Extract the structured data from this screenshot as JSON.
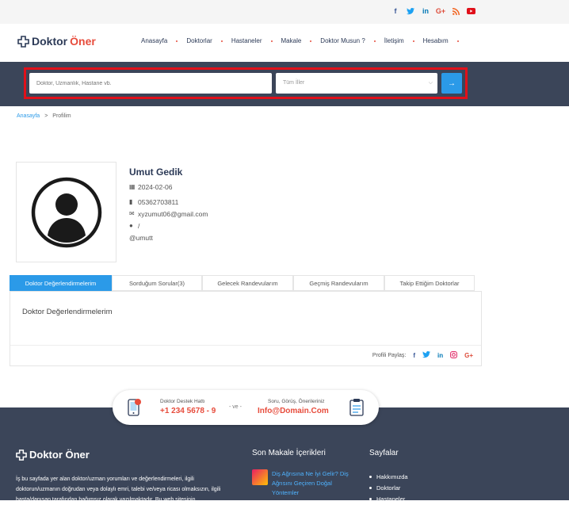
{
  "social": {
    "facebook": "f",
    "twitter": "t",
    "linkedin": "in",
    "google": "G+",
    "rss": "rss",
    "youtube": "yt"
  },
  "header": {
    "logo_part1": "Doktor",
    "logo_part2": "Öner",
    "nav": [
      "Anasayfa",
      "Doktorlar",
      "Hastaneler",
      "Makale",
      "Doktor Musun ?",
      "İletişim",
      "Hesabım"
    ]
  },
  "search": {
    "placeholder": "Doktor, Uzmanlık, Hastane vb.",
    "city_value": "Tüm İller",
    "submit_icon": "arrow-right-icon"
  },
  "breadcrumb": {
    "home": "Anasayfa",
    "separator": ">",
    "current": "Profilim"
  },
  "profile": {
    "name": "Umut Gedik",
    "date": "2024-02-06",
    "phone": "05362703811",
    "email": "xyzumut06@gmail.com",
    "location": "/",
    "username": "@umutt"
  },
  "tabs": {
    "items": [
      "Doktor Değerlendirmelerim",
      "Sorduğum Sorular(3)",
      "Gelecek Randevularım",
      "Geçmiş Randevularım",
      "Takip Ettiğim Doktorlar"
    ],
    "active_index": 0,
    "panel_title": "Doktor Değerlendirmelerim"
  },
  "share": {
    "label": "Profili Paylaş:",
    "icons": [
      "facebook-icon",
      "twitter-icon",
      "linkedin-icon",
      "instagram-icon",
      "google-plus-icon"
    ]
  },
  "contact": {
    "hotline_label": "Doktor Destek Hattı",
    "hotline_phone": "+1 234 5678 - 9",
    "separator": "- ve -",
    "feedback_label": "Soru, Görüş, Önerileriniz",
    "feedback_email": "Info@Domain.Com"
  },
  "footer": {
    "logo": "Doktor Öner",
    "about": "İş bu sayfada yer alan doktor/uzman yorumları ve değerlendirmeleri, ilgili doktorun/uzmanın doğrudan veya dolaylı emri, talebi ve/veya ricası olmaksızın, ilgili hasta/danışan tarafından bağımsız olarak yazılmaktadır. Bu web sitesinin",
    "articles_title": "Son Makale İçerikleri",
    "article_1": "Diş Ağrısına Ne İyi Gelir? Diş Ağrısını Geçiren Doğal Yöntemler",
    "pages_title": "Sayfalar",
    "pages": [
      "Hakkımızda",
      "Doktorlar",
      "Hastaneler"
    ]
  },
  "colors": {
    "primary": "#2b9ae8",
    "accent": "#e74c3c",
    "dark": "#3b4559",
    "highlight_frame": "#e0101a"
  }
}
